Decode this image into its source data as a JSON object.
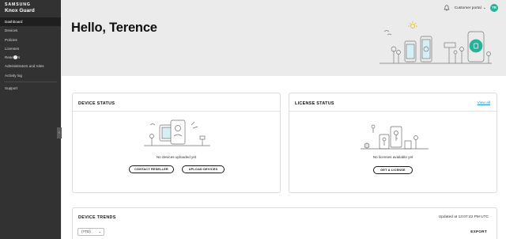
{
  "brand": {
    "line1": "SAMSUNG",
    "line2": "Knox Guard"
  },
  "sidebar": {
    "items": [
      {
        "label": "Dashboard",
        "active": true
      },
      {
        "label": "Devices"
      },
      {
        "label": "Policies"
      },
      {
        "label": "Licenses"
      },
      {
        "label": "Resellers"
      },
      {
        "label": "Administrators and roles"
      },
      {
        "label": "Activity log"
      }
    ],
    "support": "Support",
    "collapse_icon": "chevron-left-icon"
  },
  "header": {
    "portal_label": "Customer portal",
    "portal_chevron": "⌄",
    "avatar_initials": "TR",
    "avatar_color": "#2bb19a"
  },
  "greeting": "Hello, Terence",
  "device_status": {
    "title": "DEVICE STATUS",
    "empty_text": "No devices uploaded yet",
    "contact_button": "CONTACT RESELLER",
    "upload_button": "UPLOAD DEVICES"
  },
  "license_status": {
    "title": "LICENSE STATUS",
    "view_all": "View all",
    "empty_text": "No licenses available yet",
    "get_button": "GET A LICENSE"
  },
  "device_trends": {
    "title": "DEVICE TRENDS",
    "updated": "Updated at 13:07:42 PM UTC",
    "period": "(YTD)",
    "export": "EXPORT"
  },
  "colors": {
    "sidebar": "#323232",
    "accent": "#2bb19a",
    "link": "#1a9ad6"
  }
}
